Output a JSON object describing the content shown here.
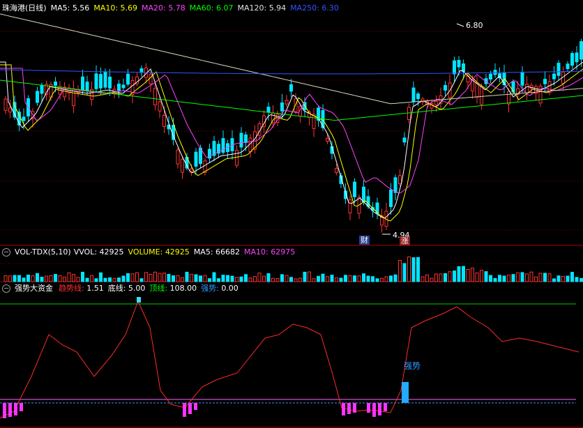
{
  "price_panel": {
    "title": "珠海港(日线)",
    "ma": [
      {
        "label": "MA5: ",
        "value": "5.56",
        "color": "#ffffff"
      },
      {
        "label": "MA10: ",
        "value": "5.69",
        "color": "#ffff00"
      },
      {
        "label": "MA20: ",
        "value": "5.78",
        "color": "#ff44ff"
      },
      {
        "label": "MA60: ",
        "value": "6.07",
        "color": "#00ff00"
      },
      {
        "label": "MA120: ",
        "value": "5.94",
        "color": "#e0e0e0"
      },
      {
        "label": "MA250: ",
        "value": "6.30",
        "color": "#3355ff"
      }
    ],
    "high_marker": "6.80",
    "low_marker": "4.94",
    "tag_cai": "财",
    "tag_zhang": "涨"
  },
  "volume_panel": {
    "title": "VOL-TDX(5,10)",
    "items": [
      {
        "label": "VVOL: ",
        "value": "42925",
        "color": "#ffffff"
      },
      {
        "label": "VOLUME: ",
        "value": "42925",
        "color": "#ffff00"
      },
      {
        "label": "MA5: ",
        "value": "66682",
        "color": "#ffffff"
      },
      {
        "label": "MA10: ",
        "value": "62975",
        "color": "#ff44ff"
      }
    ]
  },
  "indicator_panel": {
    "title": "强势大资金",
    "items": [
      {
        "label": "趋势线: ",
        "value": "1.51",
        "color": "#ff3030"
      },
      {
        "label": "底线: ",
        "value": "5.00",
        "color": "#ffffff"
      },
      {
        "label": "顶线: ",
        "value": "108.00",
        "color": "#00ff00"
      },
      {
        "label": "强势: ",
        "value": "0.00",
        "color": "#3399ff"
      }
    ],
    "signal_label": "强势"
  },
  "colors": {
    "up": "#ff3333",
    "down": "#00e5ff",
    "grid": "#8b0000",
    "panel_border": "#b00000"
  }
}
